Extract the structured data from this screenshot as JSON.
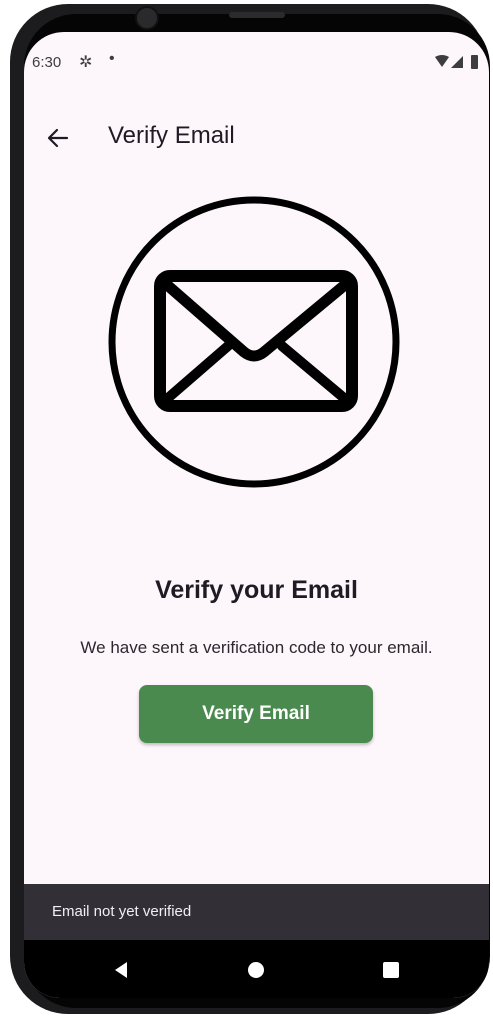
{
  "status_bar": {
    "time": "6:30",
    "icons": [
      "settings-gear-icon",
      "notification-dot-icon",
      "wifi-icon",
      "signal-icon",
      "battery-icon"
    ]
  },
  "app_bar": {
    "title": "Verify Email",
    "back_icon": "arrow-back-icon"
  },
  "illustration": {
    "icon": "mail-envelope-in-circle-icon"
  },
  "content": {
    "headline": "Verify your Email",
    "body": "We have sent a verification code to your email.",
    "button_label": "Verify Email"
  },
  "snackbar": {
    "message": "Email not yet verified"
  },
  "nav_bar": {
    "icons": [
      "nav-back-icon",
      "nav-home-icon",
      "nav-recents-icon"
    ]
  },
  "colors": {
    "background": "#fdf6fb",
    "primary_button": "#4a8a4e",
    "snackbar": "#322f37",
    "text": "#1f1b24"
  }
}
